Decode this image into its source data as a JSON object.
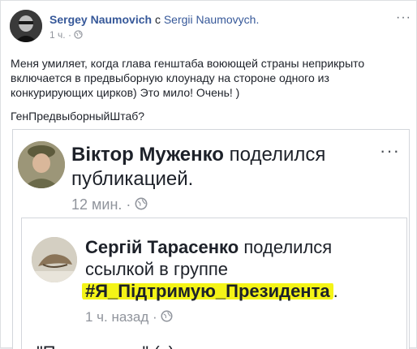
{
  "outer_post": {
    "author": "Sergey Naumovich",
    "with_text": "с",
    "with_target": "Sergii Naumovych.",
    "time": "1 ч.",
    "separator": "·",
    "more": "···",
    "body_paragraph_1": "Меня умиляет, когда глава генштаба воюющей страны неприкрыто включается в предвыборную клоунаду на стороне одного из конкурирующих цирков) Это мило! Очень! )",
    "body_paragraph_2": "ГенПредвыборныйШтаб?"
  },
  "shared_post": {
    "author": "Віктор Муженко",
    "action": "поделился публикацией.",
    "time": "12 мин.",
    "separator": "·",
    "more": "···"
  },
  "nested_post": {
    "author": "Сергій Тарасенко",
    "action": "поделился ссылкой в группе",
    "group": "#Я_Підтримую_Президента",
    "group_suffix": ".",
    "time": "1 ч. назад",
    "separator": "·",
    "cut_text": "\"Посмотрите\" (с)"
  },
  "colors": {
    "link_blue": "#365899",
    "meta_gray": "#90949c",
    "highlight_yellow": "#f4f417"
  }
}
